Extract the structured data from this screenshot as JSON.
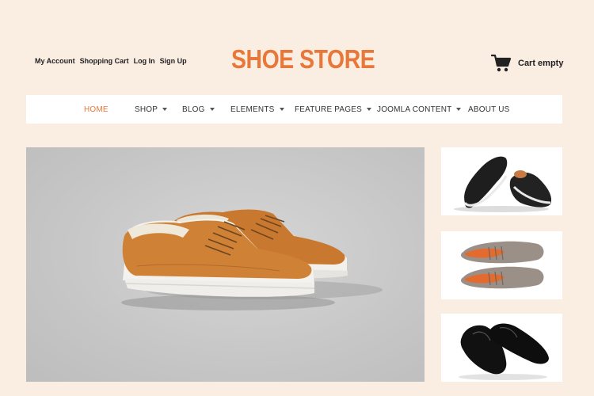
{
  "header": {
    "account_links": [
      "My Account",
      "Shopping Cart",
      "Log In",
      "Sign Up"
    ],
    "logo": "SHOE STORE",
    "cart_label": "Cart empty",
    "cart_icon": "cart-icon"
  },
  "nav": {
    "items": [
      {
        "label": "HOME",
        "active": true,
        "dropdown": false
      },
      {
        "label": "SHOP",
        "active": false,
        "dropdown": true
      },
      {
        "label": "BLOG",
        "active": false,
        "dropdown": true
      },
      {
        "label": "ELEMENTS",
        "active": false,
        "dropdown": true
      },
      {
        "label": "FEATURE PAGES",
        "active": false,
        "dropdown": true
      },
      {
        "label": "JOOMLA CONTENT",
        "active": false,
        "dropdown": true
      },
      {
        "label": "ABOUT US",
        "active": false,
        "dropdown": false
      }
    ]
  },
  "colors": {
    "background": "#faede2",
    "accent": "#e8773a",
    "nav_background": "#ffffff"
  },
  "hero": {
    "image": "brown-leather-sneakers"
  },
  "thumbnails": [
    {
      "image": "black-suede-shoes"
    },
    {
      "image": "grey-orange-shoes"
    },
    {
      "image": "black-leather-oxfords"
    }
  ]
}
